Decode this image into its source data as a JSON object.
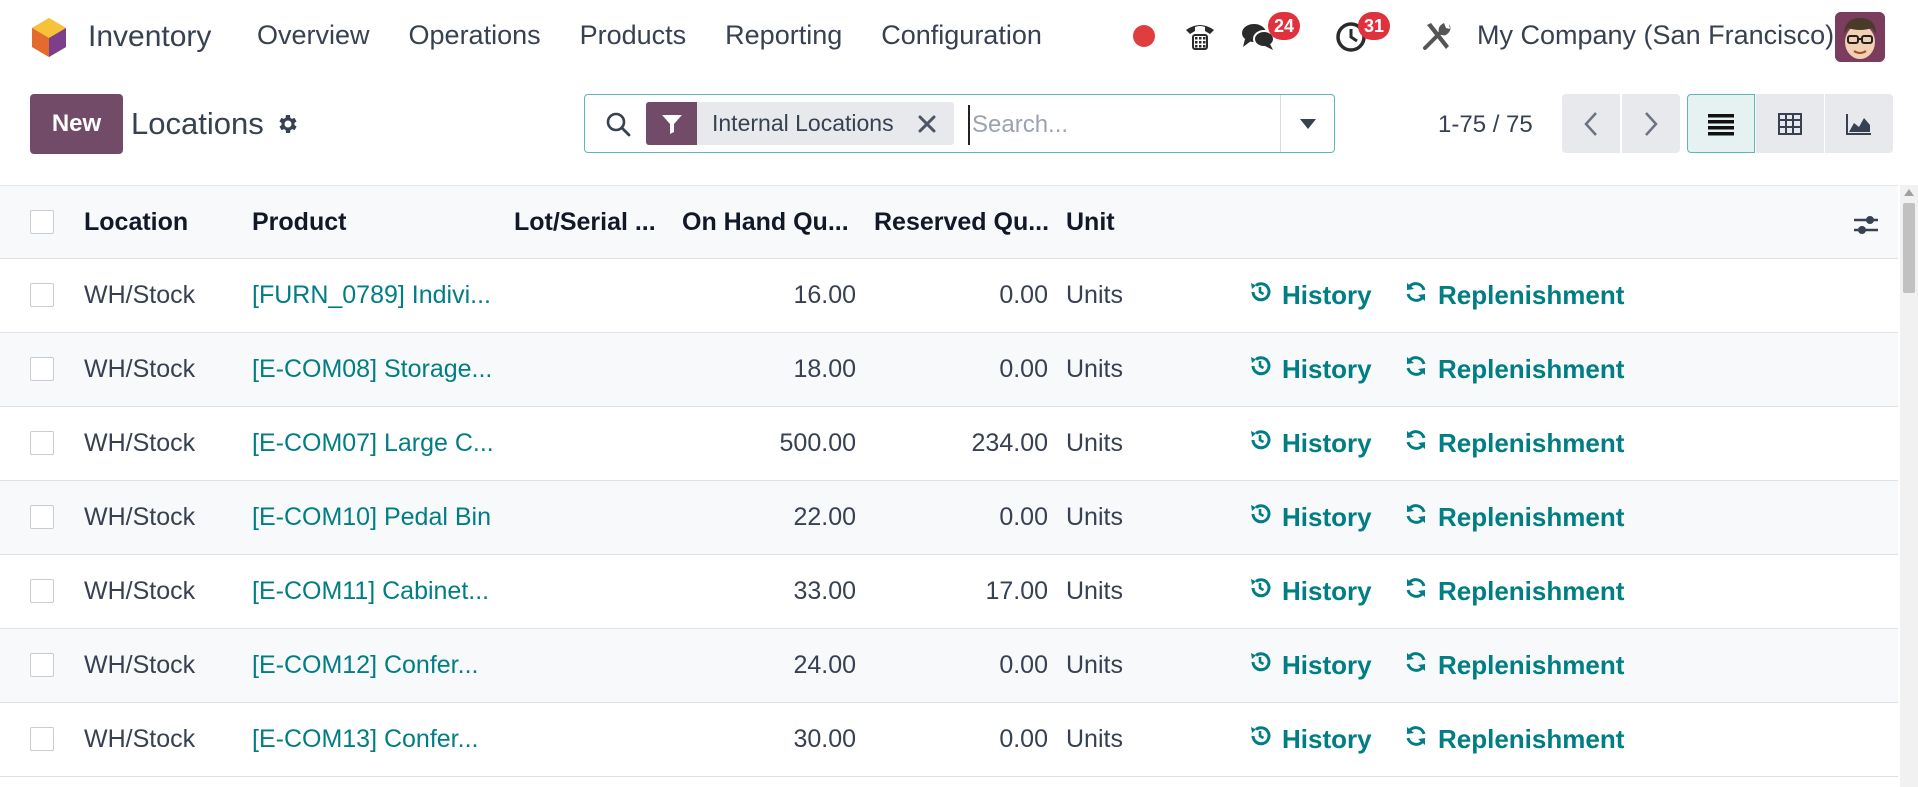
{
  "navbar": {
    "app_name": "Inventory",
    "menu": [
      "Overview",
      "Operations",
      "Products",
      "Reporting",
      "Configuration"
    ],
    "messages_badge": "24",
    "activities_badge": "31",
    "company": "My Company (San Francisco)"
  },
  "control_panel": {
    "new_label": "New",
    "title": "Locations",
    "search": {
      "facet_label": "Internal Locations",
      "placeholder": "Search..."
    },
    "pager": "1-75 / 75"
  },
  "list": {
    "columns": [
      "Location",
      "Product",
      "Lot/Serial ...",
      "On Hand Qu...",
      "Reserved Qu...",
      "Unit"
    ],
    "action_history": "History",
    "action_replenishment": "Replenishment",
    "rows": [
      {
        "location": "WH/Stock",
        "product": "[FURN_0789] Indivi...",
        "lot": "",
        "on_hand": "16.00",
        "reserved": "0.00",
        "unit": "Units"
      },
      {
        "location": "WH/Stock",
        "product": "[E-COM08] Storage...",
        "lot": "",
        "on_hand": "18.00",
        "reserved": "0.00",
        "unit": "Units"
      },
      {
        "location": "WH/Stock",
        "product": "[E-COM07] Large C...",
        "lot": "",
        "on_hand": "500.00",
        "reserved": "234.00",
        "unit": "Units"
      },
      {
        "location": "WH/Stock",
        "product": "[E-COM10] Pedal Bin",
        "lot": "",
        "on_hand": "22.00",
        "reserved": "0.00",
        "unit": "Units"
      },
      {
        "location": "WH/Stock",
        "product": "[E-COM11] Cabinet...",
        "lot": "",
        "on_hand": "33.00",
        "reserved": "17.00",
        "unit": "Units"
      },
      {
        "location": "WH/Stock",
        "product": "[E-COM12] Confer...",
        "lot": "",
        "on_hand": "24.00",
        "reserved": "0.00",
        "unit": "Units"
      },
      {
        "location": "WH/Stock",
        "product": "[E-COM13] Confer...",
        "lot": "",
        "on_hand": "30.00",
        "reserved": "0.00",
        "unit": "Units"
      }
    ]
  },
  "colors": {
    "brand": "#714b67",
    "link": "#017e84",
    "badge": "#e0323d",
    "record": "#e03e3e"
  }
}
